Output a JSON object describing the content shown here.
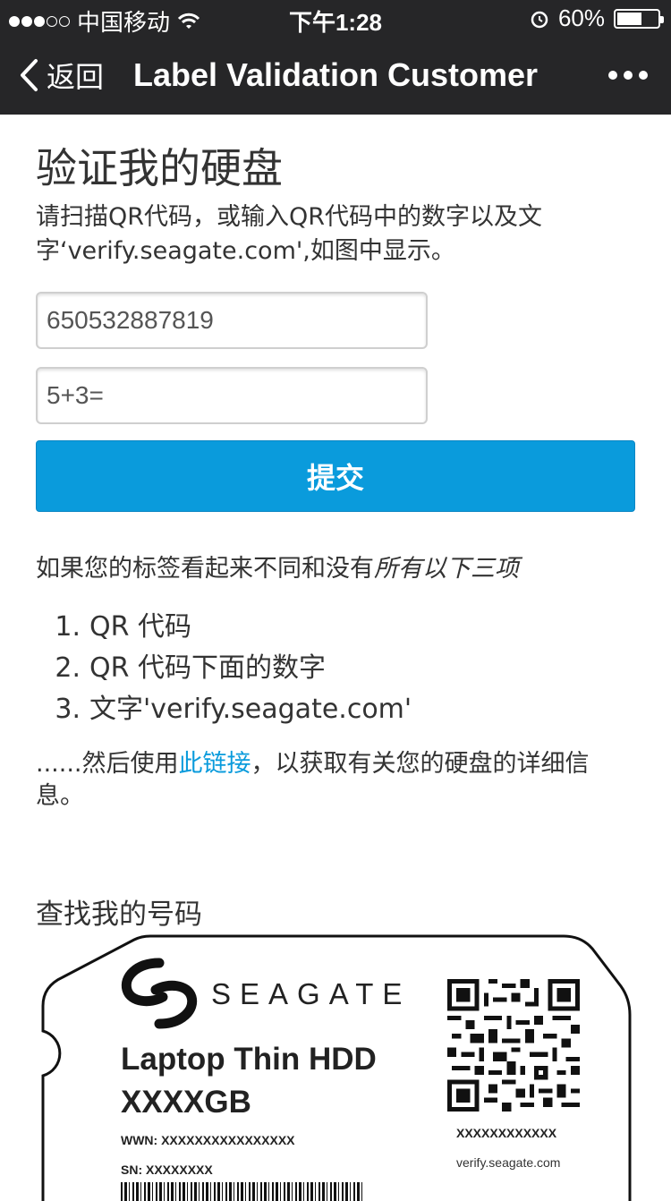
{
  "status_bar": {
    "carrier": "中国移动",
    "time": "下午1:28",
    "battery_pct": "60%"
  },
  "nav": {
    "back": "返回",
    "title": "Label Validation Customer"
  },
  "page": {
    "title": "验证我的硬盘",
    "instructions": "请扫描QR代码，或输入QR代码中的数字以及文字‘verify.seagate.com',如图中显示。",
    "serial_value": "650532887819",
    "captcha_value": "5+3=",
    "submit_label": "提交",
    "notice_prefix": "如果您的标签看起来不同和没有",
    "notice_italic": "所有以下三项",
    "requirements": [
      {
        "num": "1.",
        "text": "QR 代码"
      },
      {
        "num": "2.",
        "text": "QR 代码下面的数字"
      },
      {
        "num": "3.",
        "text": "文字'verify.seagate.com'"
      }
    ],
    "footer_prefix": "......然后使用",
    "footer_link": "此链接",
    "footer_suffix": "，以获取有关您的硬盘的详细信息。",
    "find_title": "查找我的号码"
  },
  "label": {
    "brand": "SEAGATE",
    "product_line1": "Laptop Thin HDD",
    "product_line2": "XXXXGB",
    "wwn": "WWN: XXXXXXXXXXXXXXXX",
    "sn": "SN: XXXXXXXX",
    "code": "XXXXXXXXXXXX",
    "url": "verify.seagate.com"
  },
  "icons": [
    "wifi-icon",
    "alarm-icon",
    "battery-icon",
    "back-chevron-icon",
    "more-icon",
    "seagate-logo",
    "qr-code"
  ]
}
